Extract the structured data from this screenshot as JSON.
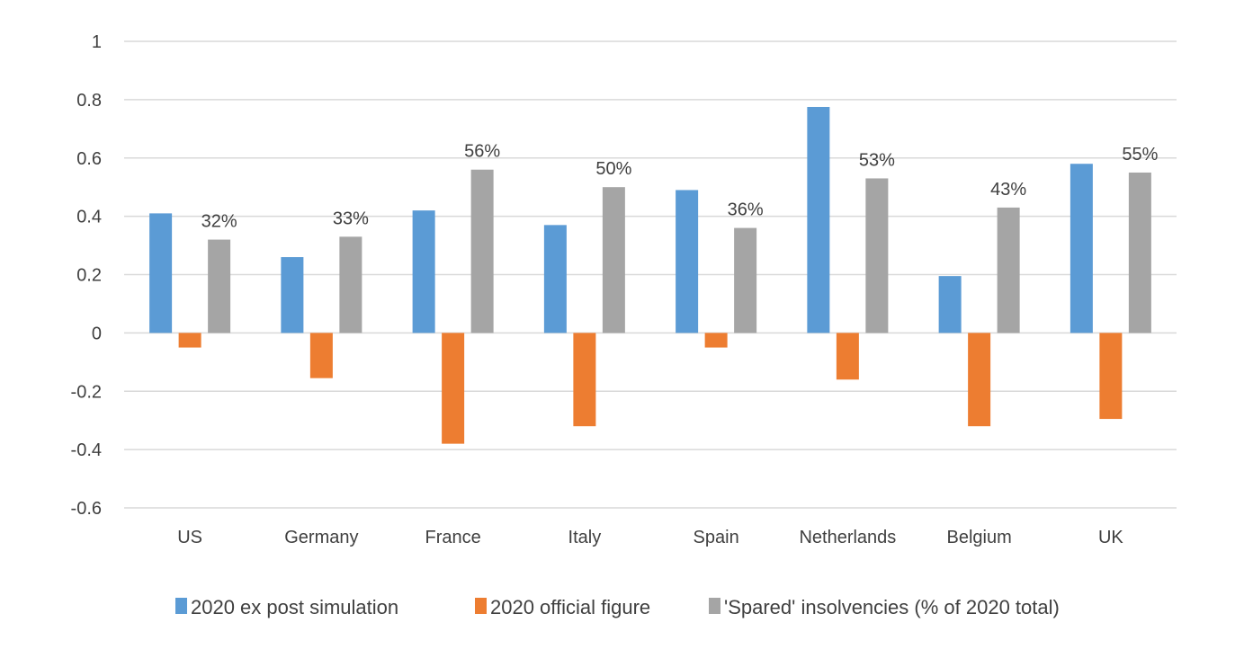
{
  "chart_data": {
    "type": "bar",
    "title": "",
    "xlabel": "",
    "ylabel": "",
    "ylim": [
      -0.6,
      1
    ],
    "yticks": [
      1,
      0.8,
      0.6,
      0.4,
      0.2,
      0,
      -0.2,
      -0.4,
      -0.6
    ],
    "ytick_labels": [
      "1",
      "0.8",
      "0.6",
      "0.4",
      "0.2",
      "0",
      "-0.2",
      "-0.4",
      "-0.6"
    ],
    "grid": true,
    "legend_position": "bottom",
    "categories": [
      "US",
      "Germany",
      "France",
      "Italy",
      "Spain",
      "Netherlands",
      "Belgium",
      "UK"
    ],
    "series": [
      {
        "name": "2020 ex post simulation",
        "color": "#5b9bd5",
        "values": [
          0.41,
          0.26,
          0.42,
          0.37,
          0.49,
          0.775,
          0.195,
          0.58
        ]
      },
      {
        "name": "2020 official figure",
        "color": "#ed7d31",
        "values": [
          -0.05,
          -0.155,
          -0.38,
          -0.32,
          -0.05,
          -0.16,
          -0.32,
          -0.295
        ]
      },
      {
        "name": "'Spared' insolvencies (% of 2020 total)",
        "color": "#a5a5a5",
        "values": [
          0.32,
          0.33,
          0.56,
          0.5,
          0.36,
          0.53,
          0.43,
          0.55
        ],
        "data_labels": [
          "32%",
          "33%",
          "56%",
          "50%",
          "36%",
          "53%",
          "43%",
          "55%"
        ]
      }
    ]
  }
}
